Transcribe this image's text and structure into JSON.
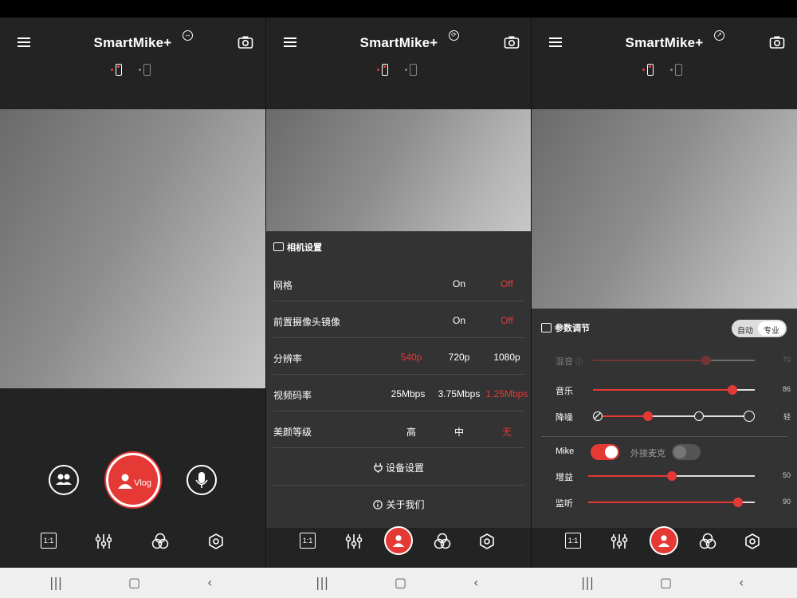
{
  "app": {
    "title": "SmartMike+"
  },
  "header": {
    "badges": [
      "↔",
      "⟳",
      "↗"
    ]
  },
  "panel1": {
    "vlog_label": "Vlog"
  },
  "bottom_bar": {
    "ratio_label": "1:1"
  },
  "settings": {
    "title": "相机设置",
    "rows": [
      {
        "label": "网格",
        "options": [
          "On",
          "Off"
        ],
        "active": 1
      },
      {
        "label": "前置摄像头镜像",
        "options": [
          "On",
          "Off"
        ],
        "active": 1
      },
      {
        "label": "分辨率",
        "options": [
          "540p",
          "720p",
          "1080p"
        ],
        "active": 0
      },
      {
        "label": "视频码率",
        "options": [
          "25Mbps",
          "3.75Mbps",
          "1.25Mbps"
        ],
        "active": 2
      },
      {
        "label": "美颜等级",
        "options": [
          "高",
          "中",
          "无"
        ],
        "active": 2
      }
    ],
    "device_settings": "设备设置",
    "about_us": "关于我们"
  },
  "params": {
    "title": "参数调节",
    "mode_auto": "自动",
    "mode_pro": "专业",
    "mix": {
      "label": "混音",
      "value": "70",
      "level": 0.7
    },
    "music": {
      "label": "音乐",
      "value": "86",
      "level": 0.86
    },
    "noise": {
      "label": "降噪",
      "end_label": "轻",
      "level": 0.33
    },
    "mike": {
      "label": "Mike",
      "external_label": "外接麦克",
      "mike_on": true,
      "external_on": false
    },
    "gain": {
      "label": "增益",
      "value": "50",
      "level": 0.5
    },
    "monitor": {
      "label": "监听",
      "value": "90",
      "level": 0.9
    }
  },
  "colors": {
    "accent": "#e53935",
    "panel_bg": "#232323",
    "sheet_bg": "#343434"
  },
  "icons": [
    "menu-icon",
    "camera-switch-icon",
    "mic-transmitter-icon",
    "phone-receiver-icon",
    "people-icon",
    "microphone-icon",
    "aspect-ratio-icon",
    "sliders-icon",
    "filters-icon",
    "settings-hexagon-icon",
    "user-icon",
    "back-icon",
    "home-icon",
    "recents-icon"
  ]
}
